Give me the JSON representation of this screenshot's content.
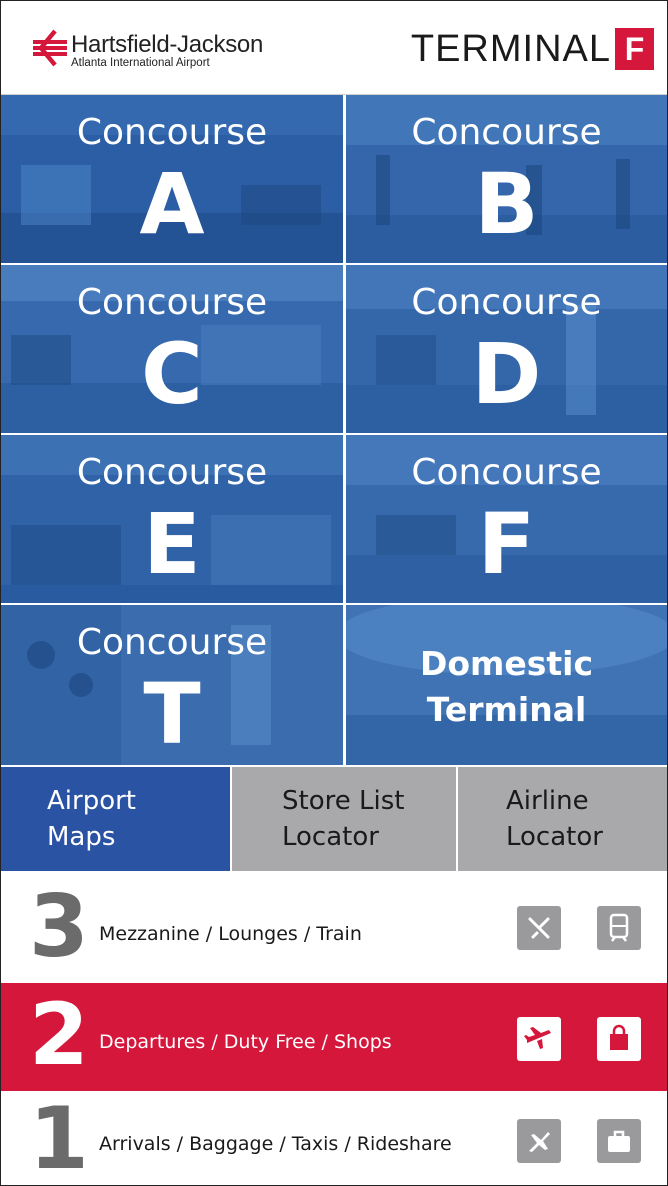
{
  "header": {
    "logo_name": "Hartsfield-Jackson",
    "logo_sub": "Atlanta International Airport",
    "terminal_label": "TERMINAL",
    "terminal_letter": "F"
  },
  "concourses": [
    {
      "word": "Concourse",
      "letter": "A"
    },
    {
      "word": "Concourse",
      "letter": "B"
    },
    {
      "word": "Concourse",
      "letter": "C"
    },
    {
      "word": "Concourse",
      "letter": "D"
    },
    {
      "word": "Concourse",
      "letter": "E"
    },
    {
      "word": "Concourse",
      "letter": "F"
    },
    {
      "word": "Concourse",
      "letter": "T"
    }
  ],
  "domestic": {
    "line1": "Domestic",
    "line2": "Terminal"
  },
  "tabs": [
    {
      "line1": "Airport",
      "line2": "Maps",
      "active": true
    },
    {
      "line1": "Store List",
      "line2": "Locator",
      "active": false
    },
    {
      "line1": "Airline",
      "line2": "Locator",
      "active": false
    }
  ],
  "floors": [
    {
      "number": "3",
      "label": "Mezzanine / Lounges / Train",
      "icons": [
        "dining-icon",
        "train-icon"
      ]
    },
    {
      "number": "2",
      "label": "Departures / Duty Free / Shops",
      "icons": [
        "departures-plane-icon",
        "shopping-bag-icon"
      ],
      "active": true
    },
    {
      "number": "1",
      "label": "Arrivals / Baggage / Taxis / Rideshare",
      "icons": [
        "arrivals-plane-icon",
        "baggage-icon"
      ]
    }
  ],
  "colors": {
    "brand_red": "#d4173b",
    "tile_blue": "#2a5fa6",
    "active_tab_blue": "#2b53a4",
    "tab_gray": "#a9a9ab",
    "icon_gray": "#9a9a9c",
    "floor_gray_text": "#6b6b6b"
  }
}
